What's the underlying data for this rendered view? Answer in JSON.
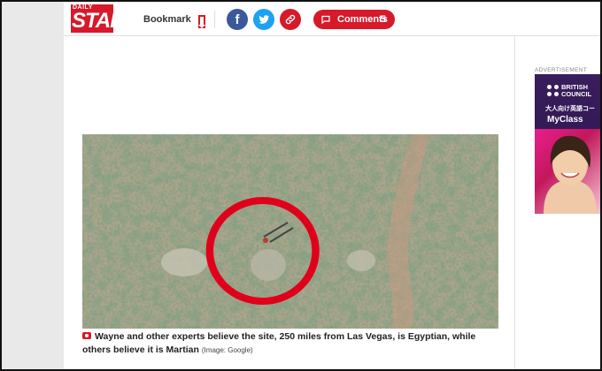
{
  "header": {
    "logo_top": "DAILY",
    "logo_main": "STAR",
    "bookmark_label": "Bookmark",
    "comments_label": "Comments",
    "comments_count": "5"
  },
  "social": {
    "facebook_glyph": "f",
    "facebook_icon": "facebook-icon",
    "twitter_icon": "twitter-icon",
    "link_icon": "link-icon"
  },
  "article": {
    "caption_text": "Wayne and other experts believe the site, 250 miles from Las Vegas, is Egyptian, while others believe it is Martian",
    "caption_credit": "(Image: Google)"
  },
  "ad": {
    "label": "ADVERTISEMENT",
    "brand_line1": "BRITISH",
    "brand_line2": "COUNCIL",
    "jp_text": "大人向け英語コー",
    "product": "MyClass"
  },
  "colors": {
    "brand_red": "#d7192a",
    "facebook": "#3b5998",
    "twitter": "#1da1f2",
    "ad_purple": "#3a1d5c"
  }
}
